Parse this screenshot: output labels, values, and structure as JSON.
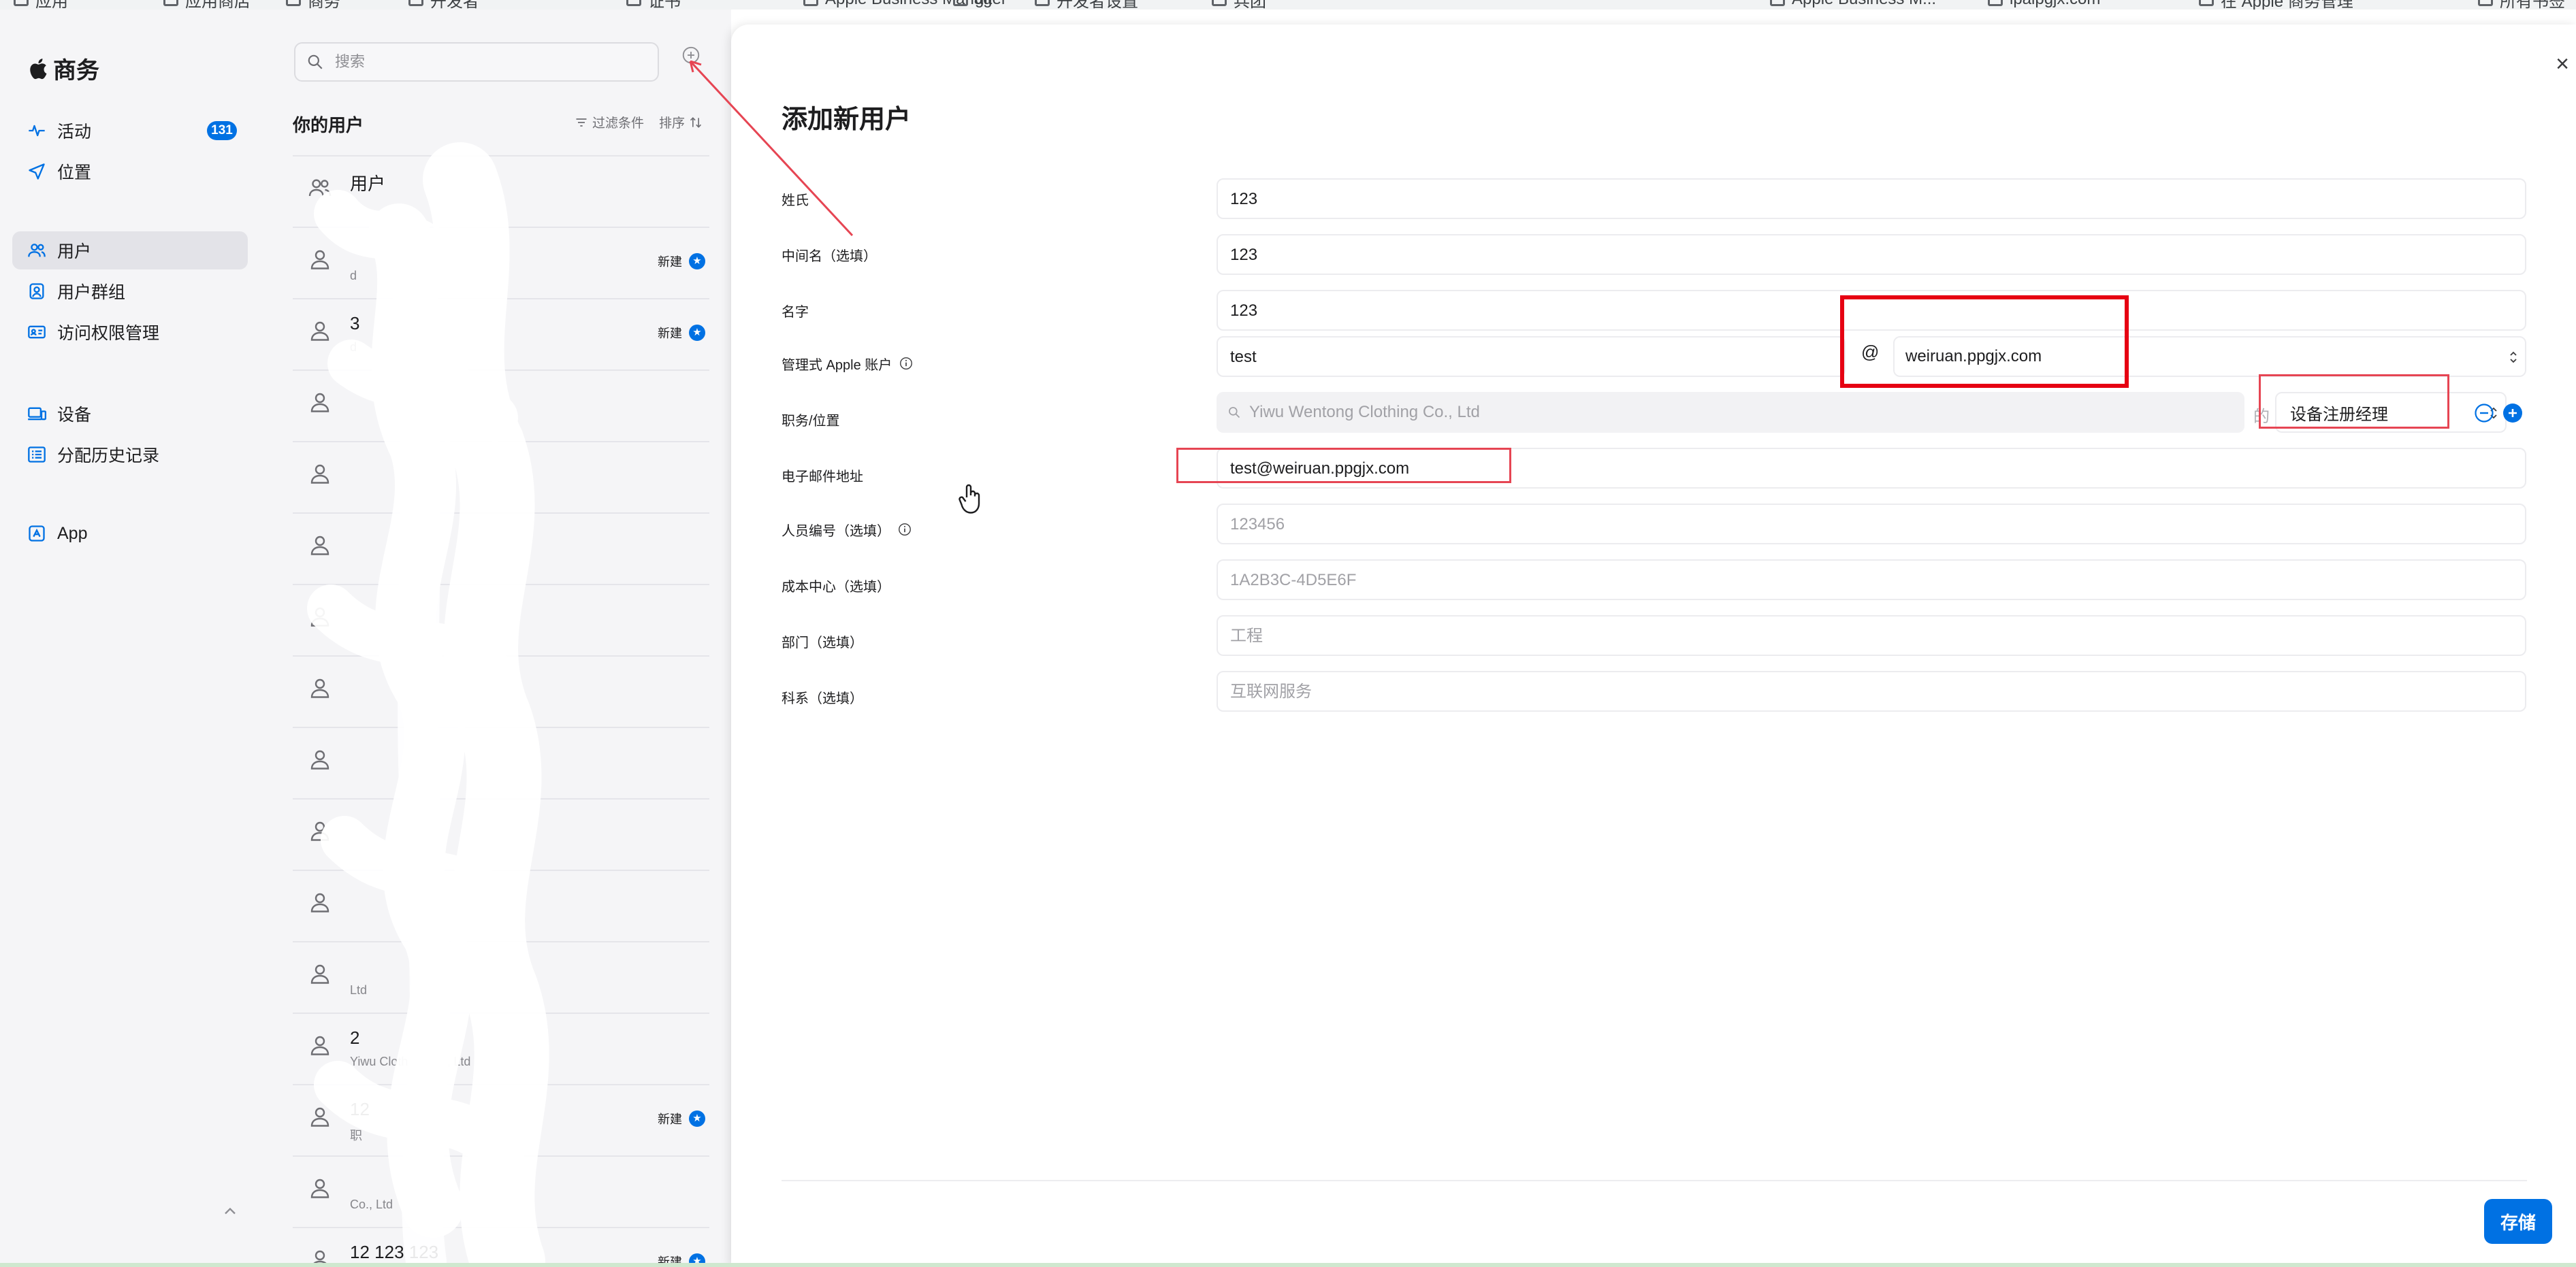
{
  "browser": {
    "bookmarks": [
      "应用",
      "应用商店",
      "商务",
      "开发者",
      "证书",
      "Apple Business Manager",
      "git",
      "开发者设置",
      "兵团",
      "Apple Business M...",
      "ipaipgjx.com",
      "在 Apple 商务管理",
      "所有书签"
    ]
  },
  "sidebar": {
    "brand": "商务",
    "items": [
      {
        "label": "活动",
        "icon": "activity-icon",
        "badge": "131"
      },
      {
        "label": "位置",
        "icon": "location-icon"
      },
      {
        "label": "用户",
        "icon": "users-icon",
        "active": true
      },
      {
        "label": "用户群组",
        "icon": "user-group-icon"
      },
      {
        "label": "访问权限管理",
        "icon": "access-management-icon"
      },
      {
        "label": "设备",
        "icon": "devices-icon"
      },
      {
        "label": "分配历史记录",
        "icon": "assignment-history-icon"
      },
      {
        "label": "App",
        "icon": "app-icon"
      }
    ]
  },
  "user_list": {
    "search_placeholder": "搜索",
    "title": "你的用户",
    "filter_label": "过滤条件",
    "sort_label": "排序",
    "rows": [
      {
        "title": "用户",
        "sub": "",
        "badge": ""
      },
      {
        "title": "",
        "sub": "d",
        "badge": "新建"
      },
      {
        "title": "3",
        "sub": "d",
        "badge": "新建"
      },
      {
        "title": "",
        "sub": "",
        "badge": ""
      },
      {
        "title": "",
        "sub": "",
        "badge": ""
      },
      {
        "title": "",
        "sub": "",
        "badge": ""
      },
      {
        "title": "",
        "sub": "",
        "badge": ""
      },
      {
        "title": "",
        "sub": "",
        "badge": ""
      },
      {
        "title": "",
        "sub": "",
        "badge": ""
      },
      {
        "title": "",
        "sub": "",
        "badge": ""
      },
      {
        "title": "",
        "sub": "",
        "badge": ""
      },
      {
        "title": "",
        "sub": "Ltd",
        "badge": ""
      },
      {
        "title": "2",
        "sub": "Yiwu Clothing Co., Ltd",
        "badge": ""
      },
      {
        "title": "12",
        "sub": "职",
        "badge": "新建"
      },
      {
        "title": "",
        "sub": "Co., Ltd",
        "badge": ""
      },
      {
        "title": "12 123 123",
        "sub": "",
        "badge": "新建"
      }
    ]
  },
  "form": {
    "title": "添加新用户",
    "close_label": "×",
    "fields": {
      "last_name": {
        "label": "姓氏",
        "value": "123"
      },
      "middle_name": {
        "label": "中间名（选填）",
        "value": "123"
      },
      "first_name": {
        "label": "名字",
        "value": "123"
      },
      "managed_account": {
        "label": "管理式 Apple 账户",
        "value": "test",
        "at": "@",
        "domain": "weiruan.ppgjx.com"
      },
      "role": {
        "label": "职务/位置",
        "company_placeholder": "Yiwu Wentong Clothing Co., Ltd",
        "of_text": "的",
        "role_value": "设备注册经理"
      },
      "email": {
        "label": "电子邮件地址",
        "value": "test@weiruan.ppgjx.com"
      },
      "employee_id": {
        "label": "人员编号（选填）",
        "placeholder": "123456"
      },
      "cost_center": {
        "label": "成本中心（选填）",
        "placeholder": "1A2B3C-4D5E6F"
      },
      "department": {
        "label": "部门（选填）",
        "placeholder": "工程"
      },
      "division": {
        "label": "科系（选填）",
        "placeholder": "互联网服务"
      }
    },
    "save_label": "存储"
  },
  "colors": {
    "accent": "#0071e3",
    "annotation": "#e60012",
    "sidebar_bg": "#f5f5f7"
  }
}
